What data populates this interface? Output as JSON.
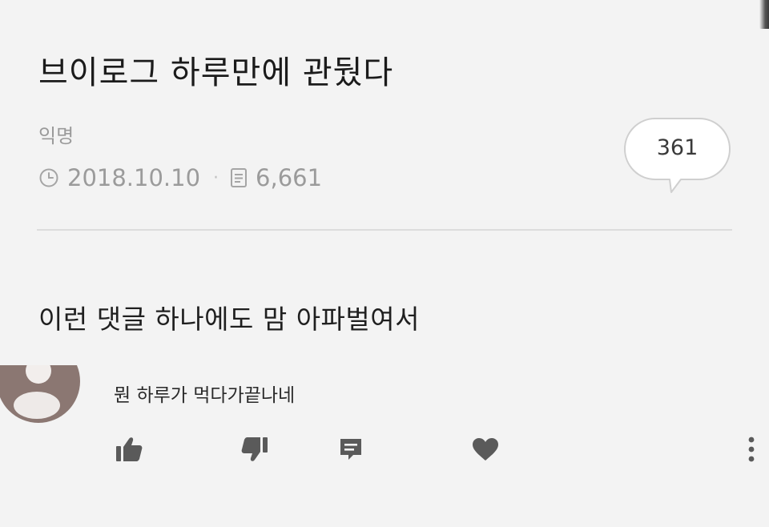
{
  "post": {
    "title": "브이로그 하루만에 관뒀다",
    "author": "익명",
    "date": "2018.10.10",
    "views": "6,661",
    "comment_count": "361",
    "body": "이런 댓글 하나에도 맘 아파벌여서"
  },
  "comment": {
    "text": "뭔 하루가 먹다가끝나네"
  },
  "icons": {
    "clock": "clock-icon",
    "views": "document-icon",
    "comment_bubble": "speech-bubble-icon",
    "like": "thumbs-up-icon",
    "dislike": "thumbs-down-icon",
    "reply": "message-icon",
    "favorite": "heart-icon",
    "more": "more-vertical-icon"
  },
  "colors": {
    "background": "#f3f3f3",
    "text": "#1e1e1e",
    "muted": "#9b9b9b",
    "icon": "#5a5a5a",
    "avatar": "#8a7670"
  }
}
